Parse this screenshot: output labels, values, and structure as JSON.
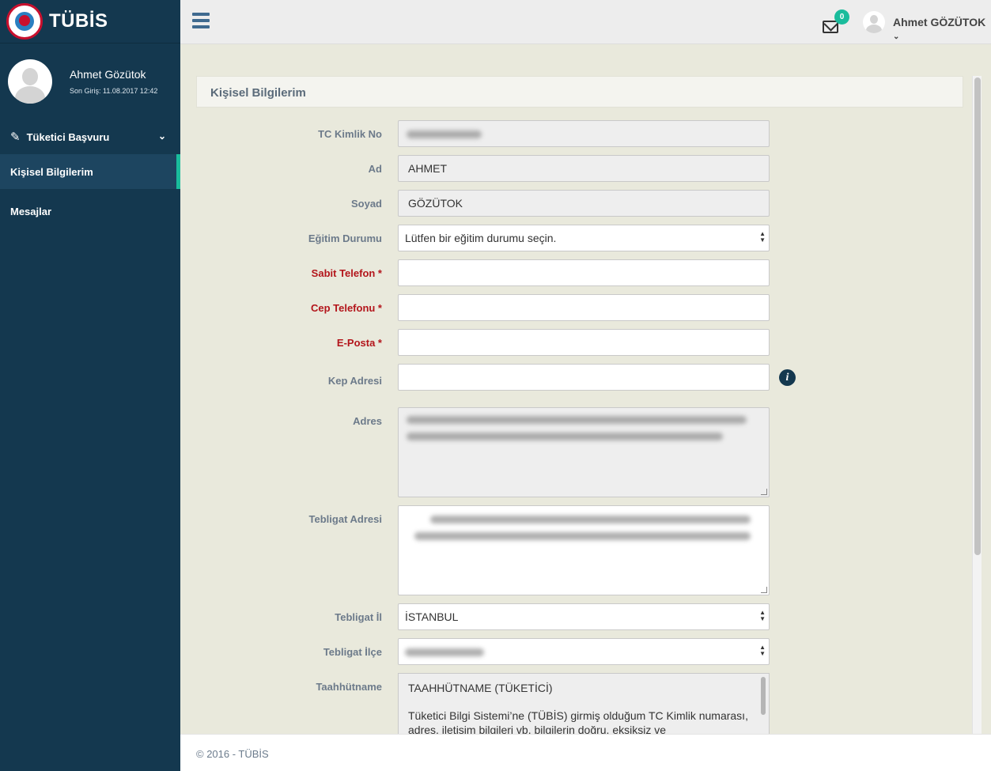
{
  "brand": {
    "name": "TÜBİS"
  },
  "profile": {
    "name": "Ahmet Gözütok",
    "last_login": "Son Giriş: 11.08.2017 12:42"
  },
  "sidebar": {
    "items": [
      {
        "label": "Tüketici Başvuru",
        "icon": "edit-icon",
        "expandable": true
      },
      {
        "label": "Kişisel Bilgilerim",
        "active": true
      },
      {
        "label": "Mesajlar"
      }
    ]
  },
  "topbar": {
    "mail_count": "0",
    "user_name": "Ahmet GÖZÜTOK"
  },
  "panel": {
    "title": "Kişisel Bilgilerim"
  },
  "form": {
    "tc_label": "TC Kimlik No",
    "tc_value_hidden": true,
    "ad_label": "Ad",
    "ad_value": "AHMET",
    "soyad_label": "Soyad",
    "soyad_value": "GÖZÜTOK",
    "egitim_label": "Eğitim Durumu",
    "egitim_value": "Lütfen bir eğitim durumu seçin.",
    "sabit_label": "Sabit Telefon *",
    "cep_label": "Cep Telefonu *",
    "eposta_label": "E-Posta *",
    "kep_label": "Kep Adresi",
    "adres_label": "Adres",
    "tebligat_adres_label": "Tebligat Adresi",
    "tebligat_il_label": "Tebligat İl",
    "tebligat_il_value": "İSTANBUL",
    "tebligat_ilce_label": "Tebligat İlçe",
    "taahhutname_label": "Taahhütname",
    "taahhutname_title": "TAAHHÜTNAME (TÜKETİCİ)",
    "taahhutname_text": "Tüketici Bilgi Sistemi’ne (TÜBİS) girmiş olduğum TC Kimlik numarası, adres, iletişim bilgileri vb. bilgilerin doğru, eksiksiz ve"
  },
  "footer": {
    "text": "© 2016 - TÜBİS"
  },
  "colors": {
    "sidebar": "#14384f",
    "accent": "#1abc9c",
    "required": "#b3151b"
  }
}
